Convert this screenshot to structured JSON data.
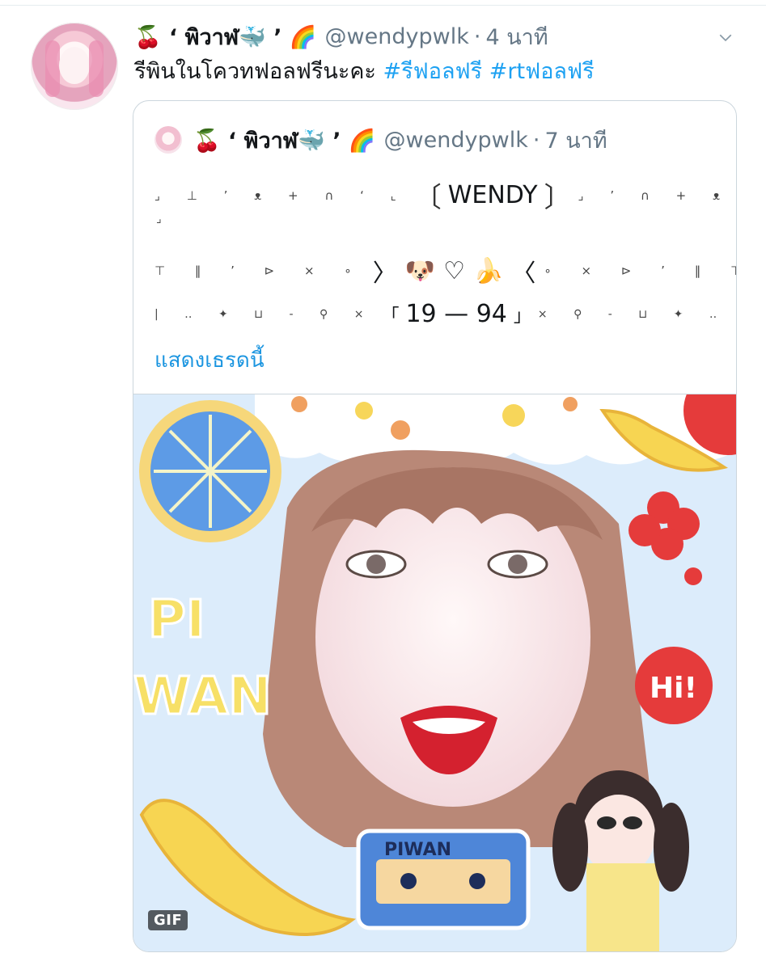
{
  "tweet": {
    "display_name": "🍒 ‘ พิวาฬ🐳 ’ 🌈",
    "handle": "@wendypwlk",
    "separator": "·",
    "time": "4 นาที",
    "text": "รีพินในโควทฟอลฟรีนะคะ",
    "hashtags": [
      "#รีฟอลฟรี",
      "#rtฟอลฟรี"
    ],
    "menu_icon": "chevron-down-icon"
  },
  "quoted": {
    "display_name": "🍒 ‘ พิวาฬ🐳 ’ 🌈",
    "handle": "@wendypwlk",
    "separator": "·",
    "time": "7 นาที",
    "line1": {
      "left": "⌟ ⊥ ’ ᴥ + ∩ ‘ ⌞",
      "bracket_l": "〔",
      "word": "WENDY",
      "bracket_r": "〕",
      "right": "⌟ ’ ∩ + ᴥ ‘ ⊥"
    },
    "line1_tail": "⌟",
    "line2": {
      "left": "⊤ ‖ ’ ⊳ × ∘",
      "bracket_l": "〉",
      "emojis": [
        "🐶",
        "♡",
        "🍌"
      ],
      "bracket_r": "〈",
      "right": "∘ × ⊳ ’ ‖ ⊤"
    },
    "line3": {
      "left": "| ‥ ✦ ⊔ - ⚲ ×",
      "open": "「",
      "numbers": "19 — 94",
      "close": "」",
      "right": "× ⚲ - ⊔ ✦ ‥ |"
    },
    "show_thread": "แสดงเธรดนี้",
    "media": {
      "type": "gif",
      "badge": "GIF",
      "labels": [
        "PI",
        "WAN",
        "Hi!",
        "PIWAN"
      ]
    }
  },
  "colors": {
    "link": "#1da1f2",
    "secondary": "#657786",
    "border": "#ccd6dd"
  }
}
